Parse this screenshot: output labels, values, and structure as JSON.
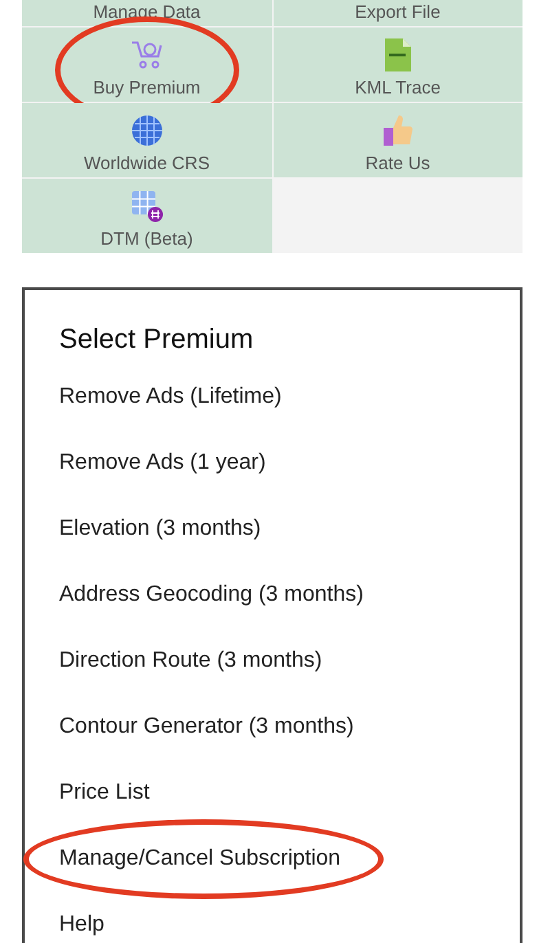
{
  "menu_tiles": [
    {
      "label": "Manage Data",
      "kind": "plain",
      "circled": false
    },
    {
      "label": "Export File",
      "kind": "plain",
      "circled": false
    },
    {
      "label": "Buy Premium",
      "kind": "cart",
      "circled": true
    },
    {
      "label": "KML Trace",
      "kind": "kml",
      "circled": false
    },
    {
      "label": "Worldwide CRS",
      "kind": "globe",
      "circled": false
    },
    {
      "label": "Rate Us",
      "kind": "thumb",
      "circled": false
    },
    {
      "label": "DTM (Beta)",
      "kind": "grid",
      "circled": false
    }
  ],
  "dialog": {
    "title": "Select Premium",
    "items": [
      {
        "label": "Remove Ads (Lifetime)",
        "circled": false
      },
      {
        "label": "Remove Ads (1 year)",
        "circled": false
      },
      {
        "label": "Elevation (3 months)",
        "circled": false
      },
      {
        "label": "Address Geocoding (3 months)",
        "circled": false
      },
      {
        "label": "Direction Route (3 months)",
        "circled": false
      },
      {
        "label": "Contour Generator (3 months)",
        "circled": false
      },
      {
        "label": "Price List",
        "circled": false
      },
      {
        "label": "Manage/Cancel Subscription",
        "circled": true
      },
      {
        "label": "Help",
        "circled": false
      }
    ]
  }
}
